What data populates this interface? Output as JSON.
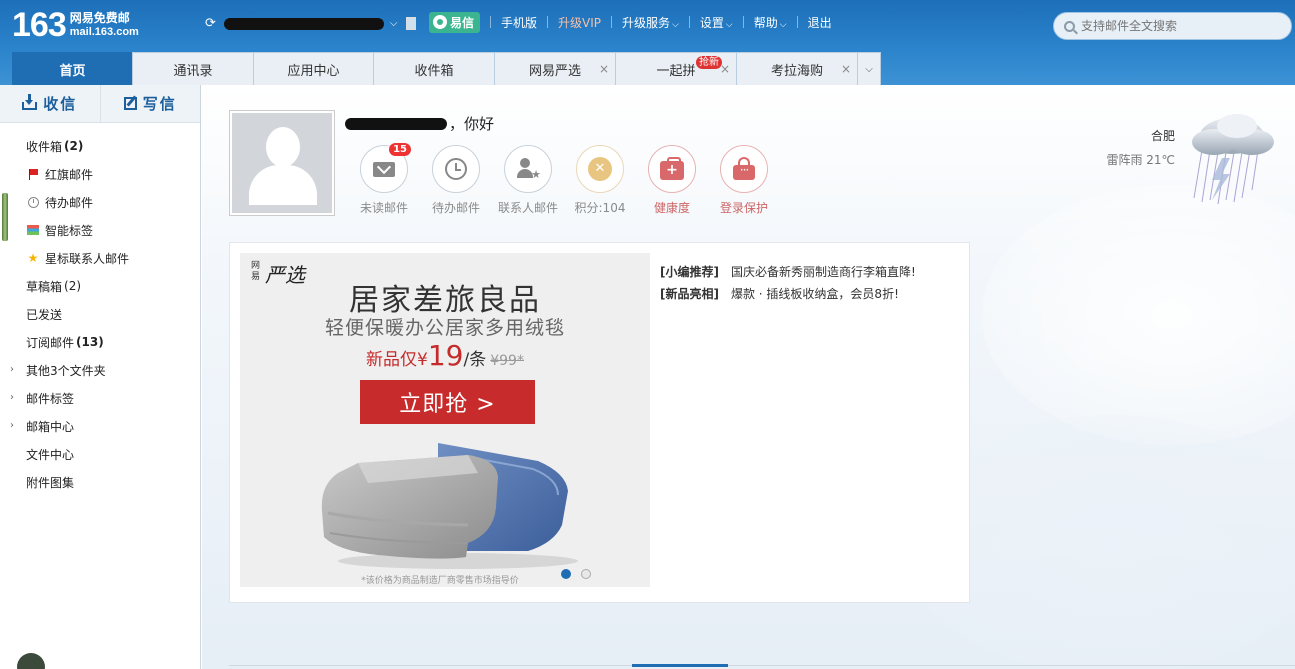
{
  "brand": {
    "number": "163",
    "name_cn": "网易免费邮",
    "domain": "mail.163.com"
  },
  "topnav": {
    "yixin": "易信",
    "mobile": "手机版",
    "vip": "升级VIP",
    "upgrade_service": "升级服务",
    "settings": "设置",
    "help": "帮助",
    "logout": "退出",
    "caret": "⌵"
  },
  "search": {
    "placeholder": "支持邮件全文搜索"
  },
  "tabs": [
    {
      "label": "首页"
    },
    {
      "label": "通讯录"
    },
    {
      "label": "应用中心"
    },
    {
      "label": "收件箱"
    },
    {
      "label": "网易严选",
      "close": "×"
    },
    {
      "label": "一起拼",
      "badge": "抢新",
      "close": "×"
    },
    {
      "label": "考拉海购",
      "close": "×"
    },
    {
      "label": "⌵"
    }
  ],
  "sidebar": {
    "receive": "收信",
    "write": "写信",
    "folders": [
      {
        "label": "收件箱",
        "count": "(2)"
      },
      {
        "label": "红旗邮件"
      },
      {
        "label": "待办邮件"
      },
      {
        "label": "智能标签"
      },
      {
        "label": "星标联系人邮件"
      },
      {
        "label": "草稿箱",
        "count": "(2)"
      },
      {
        "label": "已发送"
      },
      {
        "label": "订阅邮件",
        "count": "(13)"
      },
      {
        "label": "其他3个文件夹"
      },
      {
        "label": "邮件标签"
      },
      {
        "label": "邮箱中心"
      },
      {
        "label": "文件中心"
      },
      {
        "label": "附件图集"
      }
    ],
    "arrow": "›"
  },
  "greeting": {
    "suffix": "，你好"
  },
  "quick": [
    {
      "label": "未读邮件",
      "badge": "15"
    },
    {
      "label": "待办邮件"
    },
    {
      "label": "联系人邮件"
    },
    {
      "label": "积分:104"
    },
    {
      "label": "健康度"
    },
    {
      "label": "登录保护"
    }
  ],
  "weather": {
    "city": "合肥",
    "desc": "雷阵雨 21℃"
  },
  "banner": {
    "brand_small": "网易",
    "brand_big": "严选",
    "title": "居家差旅良品",
    "subtitle": "轻便保暖办公居家多用绒毯",
    "price_prefix": "新品仅¥",
    "price_value": "19",
    "price_unit": "/条",
    "price_old": "¥99*",
    "cta": "立即抢 >",
    "note": "*该价格为商品制造厂商零售市场指导价"
  },
  "recs": [
    {
      "tag": "[小编推荐]",
      "text": "国庆必备新秀丽制造商行李箱直降!"
    },
    {
      "tag": "[新品亮相]",
      "text": "爆款 · 插线板收纳盒，会员8折!"
    }
  ],
  "colors": {
    "accent": "#1f6eb4",
    "topbar": "#2a83cb",
    "cta": "#c72b2b"
  }
}
